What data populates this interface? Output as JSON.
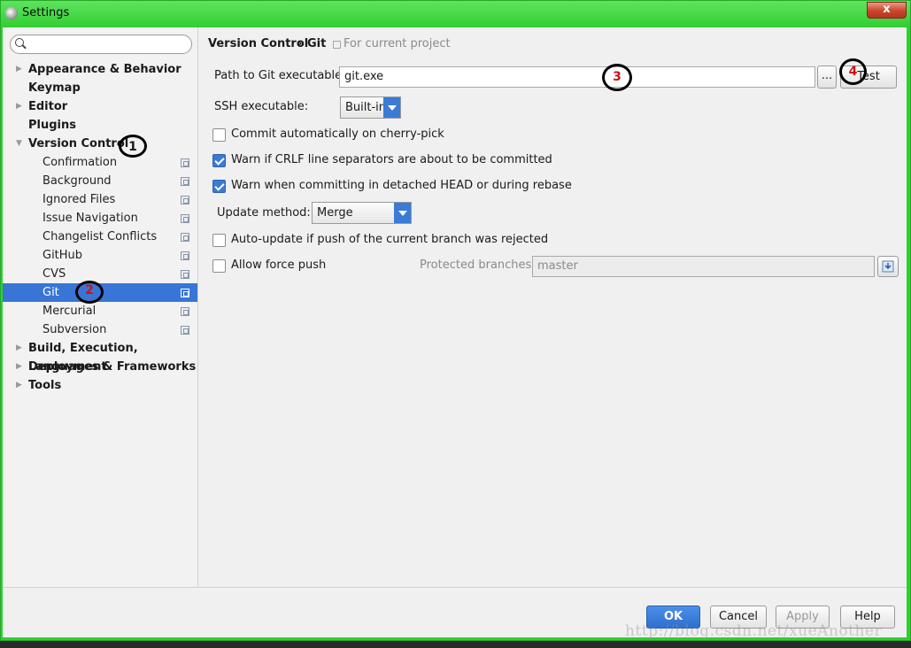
{
  "window": {
    "title": "Settings",
    "close_glyph": "x"
  },
  "search": {
    "placeholder": "",
    "value": ""
  },
  "tree": {
    "top_before": [
      {
        "label": "Appearance & Behavior",
        "arrow": "▶"
      },
      {
        "label": "Keymap",
        "arrow": ""
      },
      {
        "label": "Editor",
        "arrow": "▶"
      },
      {
        "label": "Plugins",
        "arrow": ""
      },
      {
        "label": "Version Control",
        "arrow": "▼"
      }
    ],
    "vc_children": [
      "Confirmation",
      "Background",
      "Ignored Files",
      "Issue Navigation",
      "Changelist Conflicts",
      "GitHub",
      "CVS",
      "Git",
      "Mercurial",
      "Subversion"
    ],
    "selected": "Git",
    "top_after": [
      {
        "label": "Build, Execution, Deployment",
        "arrow": "▶"
      },
      {
        "label": "Languages & Frameworks",
        "arrow": "▶"
      },
      {
        "label": "Tools",
        "arrow": "▶"
      }
    ]
  },
  "breadcrumb": {
    "section": "Version Control",
    "separator": "›",
    "page": "Git",
    "scope": "For current project"
  },
  "form": {
    "path_label": "Path to Git executable:",
    "path_value": "git.exe",
    "browse_label": "...",
    "test_label": "Test",
    "ssh_label": "SSH executable:",
    "ssh_value": "Built-in",
    "commit_cherry_label": "Commit automatically on cherry-pick",
    "commit_cherry_checked": false,
    "warn_crlf_label": "Warn if CRLF line separators are about to be committed",
    "warn_crlf_checked": true,
    "warn_detached_label": "Warn when committing in detached HEAD or during rebase",
    "warn_detached_checked": true,
    "update_method_label": "Update method:",
    "update_method_value": "Merge",
    "auto_update_label": "Auto-update if push of the current branch was rejected",
    "auto_update_checked": false,
    "force_push_label": "Allow force push",
    "force_push_checked": false,
    "protected_label": "Protected branches:",
    "protected_value": "master"
  },
  "annotations": [
    "1",
    "2",
    "3",
    "4"
  ],
  "footer": {
    "ok": "OK",
    "cancel": "Cancel",
    "apply": "Apply",
    "help": "Help"
  },
  "watermark": "http://blog.csdn.net/xueAnother",
  "colors": {
    "selection": "#3875d7",
    "accent": "#3a7bd5",
    "window_frame": "#2fd02f",
    "annotation_red": "#d01010"
  }
}
